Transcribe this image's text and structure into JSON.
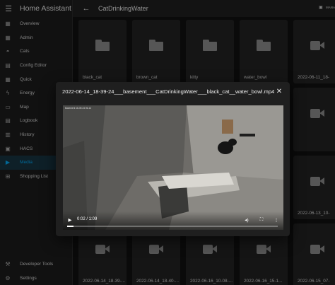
{
  "app": {
    "title": "Home Assistant"
  },
  "sidebar": {
    "items": [
      {
        "label": "Overview",
        "icon": "dashboard-icon",
        "glyph": "▦"
      },
      {
        "label": "Admin",
        "icon": "dashboard-icon",
        "glyph": "▦"
      },
      {
        "label": "Cats",
        "icon": "cat-icon",
        "glyph": "◓"
      },
      {
        "label": "Config Editor",
        "icon": "code-icon",
        "glyph": "▤"
      },
      {
        "label": "Quick",
        "icon": "dashboard-icon",
        "glyph": "▦"
      },
      {
        "label": "Energy",
        "icon": "lightning-icon",
        "glyph": "ϟ"
      },
      {
        "label": "Map",
        "icon": "map-icon",
        "glyph": "▭"
      },
      {
        "label": "Logbook",
        "icon": "logbook-icon",
        "glyph": "▤"
      },
      {
        "label": "History",
        "icon": "chart-icon",
        "glyph": "▥"
      },
      {
        "label": "HACS",
        "icon": "hacs-icon",
        "glyph": "▣"
      },
      {
        "label": "Media",
        "icon": "media-icon",
        "glyph": "▶",
        "active": true
      },
      {
        "label": "Shopping List",
        "icon": "cart-icon",
        "glyph": "⊞"
      }
    ],
    "bottom": [
      {
        "label": "Developer Tools",
        "icon": "hammer-icon",
        "glyph": "⚒"
      },
      {
        "label": "Settings",
        "icon": "gear-icon",
        "glyph": "⚙"
      }
    ]
  },
  "header": {
    "title": "CatDrinkingWater",
    "manage_label": "MANA"
  },
  "grid": {
    "cards": [
      {
        "label": "black_cat",
        "kind": "folder"
      },
      {
        "label": "brown_cat",
        "kind": "folder"
      },
      {
        "label": "kitty",
        "kind": "folder"
      },
      {
        "label": "water_bowl",
        "kind": "folder"
      },
      {
        "label": "2022-06-11_18-",
        "kind": "video"
      },
      {
        "label": "",
        "kind": "video"
      },
      {
        "label": "2022-06-13_10-",
        "kind": "video"
      },
      {
        "label": "2022-06-15_07-",
        "kind": "video"
      },
      {
        "label": "2022-06-14_18-39-...",
        "kind": "video"
      },
      {
        "label": "2022-06-14_18-40-...",
        "kind": "video"
      },
      {
        "label": "2022-06-16_10-08-...",
        "kind": "video"
      },
      {
        "label": "2022-06-16_15-1...",
        "kind": "video"
      }
    ]
  },
  "dialog": {
    "title": "2022-06-14_18-39-24___basement___CatDrinkingWater___black_cat__water_bowl.mp4",
    "video_overlay_text": "Basement 18-39-24 06-14",
    "time": "0:02 / 1:09",
    "progress_fraction": 0.029
  },
  "colors": {
    "accent": "#03a9f4",
    "background": "#111111",
    "card": "#232323"
  }
}
